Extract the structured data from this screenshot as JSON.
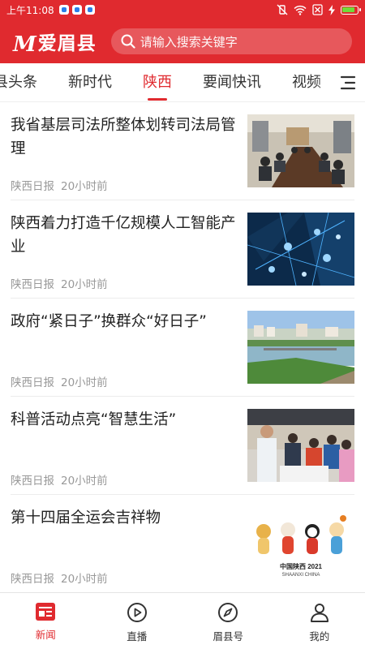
{
  "status_bar": {
    "time": "上午11:08"
  },
  "header": {
    "logo_mark": "M",
    "logo_text": "爱眉县",
    "search_placeholder": "请输入搜索关键字"
  },
  "tabs": [
    "县头条",
    "新时代",
    "陕西",
    "要闻快讯",
    "视频"
  ],
  "active_tab": "陕西",
  "feed": [
    {
      "title": "我省基层司法所整体划转司法局管理",
      "source": "陕西日报",
      "time": "20小时前"
    },
    {
      "title": "陕西着力打造千亿规模人工智能产业",
      "source": "陕西日报",
      "time": "20小时前"
    },
    {
      "title": "政府“紧日子”换群众“好日子”",
      "source": "陕西日报",
      "time": "20小时前"
    },
    {
      "title": "科普活动点亮“智慧生活”",
      "source": "陕西日报",
      "time": "20小时前"
    },
    {
      "title": "第十四届全运会吉祥物",
      "source": "陕西日报",
      "time": "20小时前"
    }
  ],
  "mascot_image_text": {
    "line1": "中国陕西 2021",
    "line2": "SHAANXI CHINA"
  },
  "bottom_nav": [
    {
      "label": "新闻"
    },
    {
      "label": "直播"
    },
    {
      "label": "眉县号"
    },
    {
      "label": "我的"
    }
  ],
  "colors": {
    "brand_red": "#e02a2f",
    "meta_gray": "#999999"
  }
}
